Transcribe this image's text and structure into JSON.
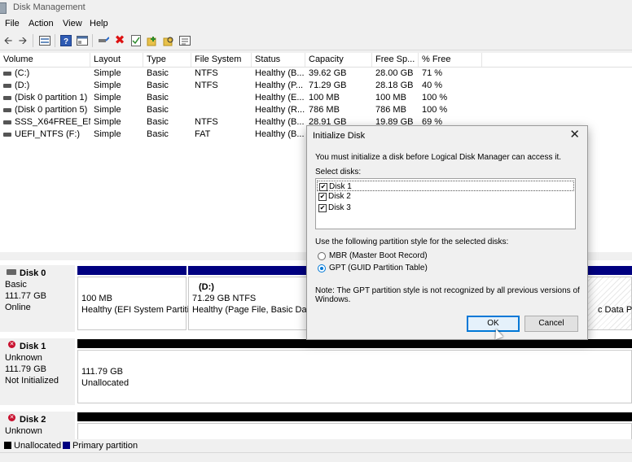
{
  "window": {
    "title": "Disk Management"
  },
  "menu": [
    "File",
    "Action",
    "View",
    "Help"
  ],
  "toolbar_icons": [
    "back-arrow-icon",
    "forward-arrow-icon",
    "disk-list-icon",
    "help-icon",
    "console-icon",
    "connect-icon",
    "delete-x-icon",
    "checklist-icon",
    "add-folder-icon",
    "folder-search-icon",
    "properties-icon"
  ],
  "columns": [
    "Volume",
    "Layout",
    "Type",
    "File System",
    "Status",
    "Capacity",
    "Free Sp...",
    "% Free"
  ],
  "volumes": [
    {
      "volume": "(C:)",
      "layout": "Simple",
      "type": "Basic",
      "fs": "NTFS",
      "status": "Healthy (B...",
      "capacity": "39.62 GB",
      "free": "28.00 GB",
      "pct": "71 %"
    },
    {
      "volume": "(D:)",
      "layout": "Simple",
      "type": "Basic",
      "fs": "NTFS",
      "status": "Healthy (P...",
      "capacity": "71.29 GB",
      "free": "28.18 GB",
      "pct": "40 %"
    },
    {
      "volume": "(Disk 0 partition 1)",
      "layout": "Simple",
      "type": "Basic",
      "fs": "",
      "status": "Healthy (E...",
      "capacity": "100 MB",
      "free": "100 MB",
      "pct": "100 %"
    },
    {
      "volume": "(Disk 0 partition 5)",
      "layout": "Simple",
      "type": "Basic",
      "fs": "",
      "status": "Healthy (R...",
      "capacity": "786 MB",
      "free": "786 MB",
      "pct": "100 %"
    },
    {
      "volume": "SSS_X64FREE_EN-...",
      "layout": "Simple",
      "type": "Basic",
      "fs": "NTFS",
      "status": "Healthy (B...",
      "capacity": "28.91 GB",
      "free": "19.89 GB",
      "pct": "69 %"
    },
    {
      "volume": "UEFI_NTFS (F:)",
      "layout": "Simple",
      "type": "Basic",
      "fs": "FAT",
      "status": "Healthy (B...",
      "capacity": "",
      "free": "",
      "pct": ""
    }
  ],
  "disks": [
    {
      "name": "Disk 0",
      "type": "Basic",
      "size": "111.77 GB",
      "state": "Online",
      "partitions": [
        {
          "title": "",
          "size": "100 MB",
          "status": "Healthy (EFI System Partitic"
        },
        {
          "title": "(D:)",
          "size": "71.29 GB NTFS",
          "status": "Healthy (Page File, Basic Data I"
        },
        {
          "title": "",
          "size": "",
          "status": "c Data Partit"
        }
      ]
    },
    {
      "name": "Disk 1",
      "type": "Unknown",
      "size": "111.79 GB",
      "state": "Not Initialized",
      "partitions": [
        {
          "size": "111.79 GB",
          "status": "Unallocated"
        }
      ]
    },
    {
      "name": "Disk 2",
      "type": "Unknown"
    }
  ],
  "legend": [
    {
      "label": "Unallocated",
      "color": "#000000"
    },
    {
      "label": "Primary partition",
      "color": "#000080"
    }
  ],
  "dialog": {
    "title": "Initialize Disk",
    "intro": "You must initialize a disk before Logical Disk Manager can access it.",
    "select_label": "Select disks:",
    "disks": [
      {
        "label": "Disk 1",
        "checked": true
      },
      {
        "label": "Disk 2",
        "checked": true
      },
      {
        "label": "Disk 3",
        "checked": true
      }
    ],
    "style_label": "Use the following partition style for the selected disks:",
    "mbr_label": "MBR (Master Boot Record)",
    "gpt_label": "GPT (GUID Partition Table)",
    "selected_style": "GPT",
    "note_line1": "Note: The GPT partition style is not recognized by all previous versions of",
    "note_line2": "Windows.",
    "ok_label": "OK",
    "cancel_label": "Cancel"
  },
  "colors": {
    "primary_partition": "#000080",
    "unallocated": "#000000",
    "accent": "#0078d7"
  }
}
